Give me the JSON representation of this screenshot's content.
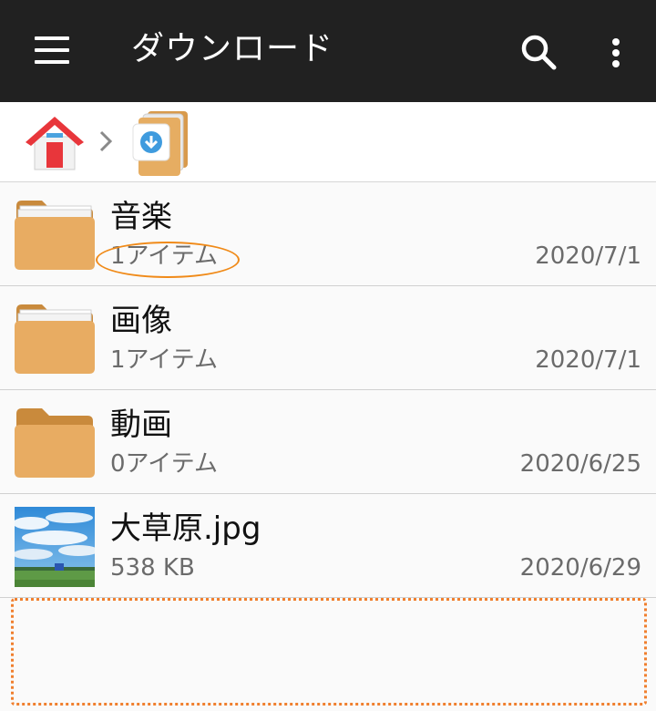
{
  "appbar": {
    "title": "ダウンロード",
    "menu_icon": "hamburger-menu-icon",
    "search_icon": "search-icon",
    "more_icon": "more-vert-icon"
  },
  "breadcrumb": {
    "home_icon": "home-icon",
    "separator_icon": "chevron-right-icon",
    "current_icon": "download-folder-icon"
  },
  "files": [
    {
      "name": "音楽",
      "meta": "1アイテム",
      "date": "2020/7/1",
      "icon": "folder-icon"
    },
    {
      "name": "画像",
      "meta": "1アイテム",
      "date": "2020/7/1",
      "icon": "folder-icon"
    },
    {
      "name": "動画",
      "meta": "0アイテム",
      "date": "2020/6/25",
      "icon": "folder-icon"
    },
    {
      "name": "大草原.jpg",
      "meta": "538 KB",
      "date": "2020/6/29",
      "icon": "image-thumbnail"
    }
  ],
  "colors": {
    "appbar": "#212121",
    "highlight": "#f08a18",
    "drop_zone": "#f07f2e",
    "folder": "#e0a75a"
  }
}
